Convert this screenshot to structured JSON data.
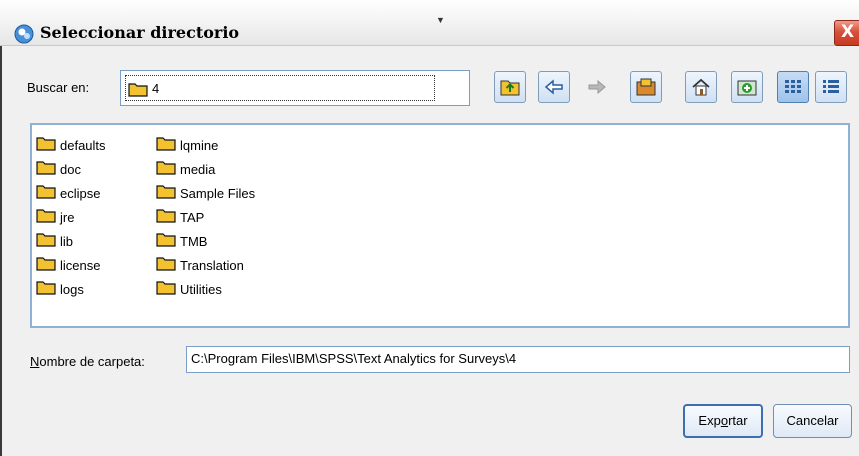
{
  "window": {
    "title": "Seleccionar directorio",
    "close_glyph": "X"
  },
  "lookin": {
    "label": "Buscar en:",
    "value": "4"
  },
  "toolbar": {
    "buttons": [
      {
        "icon": "up-folder-icon",
        "enabled": true
      },
      {
        "icon": "back-arrow-icon",
        "enabled": true
      },
      {
        "icon": "forward-arrow-icon",
        "enabled": false
      },
      {
        "icon": "desktop-icon",
        "enabled": true
      },
      {
        "icon": "home-icon",
        "enabled": true
      },
      {
        "icon": "new-folder-icon",
        "enabled": true
      },
      {
        "icon": "list-view-icon",
        "enabled": true,
        "active": true
      },
      {
        "icon": "details-view-icon",
        "enabled": true
      }
    ]
  },
  "files": {
    "column1": [
      "defaults",
      "doc",
      "eclipse",
      "jre",
      "lib",
      "license",
      "logs"
    ],
    "column2": [
      "lqmine",
      "media",
      "Sample Files",
      "TAP",
      "TMB",
      "Translation",
      "Utilities"
    ]
  },
  "folder_name": {
    "label_mnemonic": "N",
    "label_rest": "ombre de carpeta:",
    "value": "C:\\Program Files\\IBM\\SPSS\\Text Analytics for Surveys\\4"
  },
  "buttons": {
    "export_pre": "Exp",
    "export_mnemonic": "o",
    "export_post": "rtar",
    "cancel": "Cancelar"
  },
  "colors": {
    "folder": "#f2c230",
    "accent_border": "#7a9ec6",
    "close": "#d7513a"
  }
}
